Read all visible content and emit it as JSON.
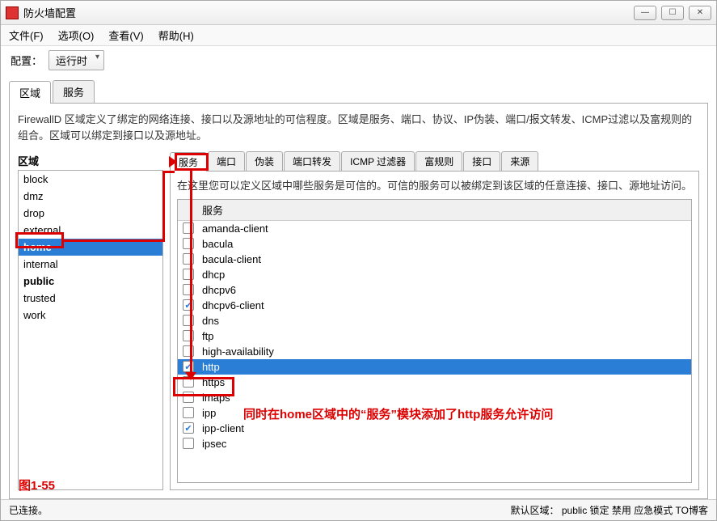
{
  "window": {
    "title": "防火墙配置"
  },
  "menu": {
    "file": "文件(F)",
    "options": "选项(O)",
    "view": "查看(V)",
    "help": "帮助(H)"
  },
  "config": {
    "label": "配置：",
    "value": "运行时"
  },
  "top_tabs": {
    "zones": "区域",
    "services": "服务"
  },
  "description": "FirewallD 区域定义了绑定的网络连接、接口以及源地址的可信程度。区域是服务、端口、协议、IP伪装、端口/报文转发、ICMP过滤以及富规则的组合。区域可以绑定到接口以及源地址。",
  "zones": {
    "header": "区域",
    "items": [
      {
        "name": "block",
        "bold": false,
        "selected": false
      },
      {
        "name": "dmz",
        "bold": false,
        "selected": false
      },
      {
        "name": "drop",
        "bold": false,
        "selected": false
      },
      {
        "name": "external",
        "bold": false,
        "selected": false
      },
      {
        "name": "home",
        "bold": true,
        "selected": true
      },
      {
        "name": "internal",
        "bold": false,
        "selected": false
      },
      {
        "name": "public",
        "bold": true,
        "selected": false
      },
      {
        "name": "trusted",
        "bold": false,
        "selected": false
      },
      {
        "name": "work",
        "bold": false,
        "selected": false
      }
    ]
  },
  "sub_tabs": {
    "items": [
      "服务",
      "端口",
      "伪装",
      "端口转发",
      "ICMP 过滤器",
      "富规则",
      "接口",
      "来源"
    ],
    "active": 0
  },
  "right_desc": "在这里您可以定义区域中哪些服务是可信的。可信的服务可以被绑定到该区域的任意连接、接口、源地址访问。",
  "svc": {
    "header": "服务",
    "rows": [
      {
        "name": "amanda-client",
        "checked": false,
        "selected": false
      },
      {
        "name": "bacula",
        "checked": false,
        "selected": false
      },
      {
        "name": "bacula-client",
        "checked": false,
        "selected": false
      },
      {
        "name": "dhcp",
        "checked": false,
        "selected": false
      },
      {
        "name": "dhcpv6",
        "checked": false,
        "selected": false
      },
      {
        "name": "dhcpv6-client",
        "checked": true,
        "selected": false
      },
      {
        "name": "dns",
        "checked": false,
        "selected": false
      },
      {
        "name": "ftp",
        "checked": false,
        "selected": false
      },
      {
        "name": "high-availability",
        "checked": false,
        "selected": false
      },
      {
        "name": "http",
        "checked": true,
        "selected": true
      },
      {
        "name": "https",
        "checked": false,
        "selected": false
      },
      {
        "name": "imaps",
        "checked": false,
        "selected": false
      },
      {
        "name": "ipp",
        "checked": false,
        "selected": false
      },
      {
        "name": "ipp-client",
        "checked": true,
        "selected": false
      },
      {
        "name": "ipsec",
        "checked": false,
        "selected": false
      }
    ]
  },
  "status": {
    "connected": "已连接。",
    "defzone": "默认区域： public 锁定 禁用 应急模式 TO博客"
  },
  "annotations": {
    "figure_label": "图1-55",
    "note": "同时在home区域中的“服务”模块添加了http服务允许访问"
  }
}
